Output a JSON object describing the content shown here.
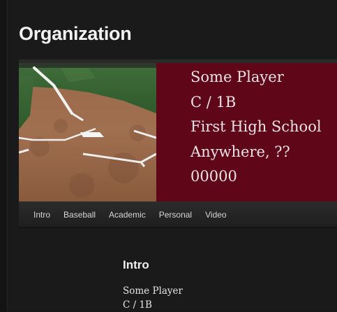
{
  "page": {
    "title": "Organization"
  },
  "hero": {
    "player_name": "Some Player",
    "positions": "C / 1B",
    "school": "First High School",
    "location": "Anywhere, ??",
    "zip": "00000",
    "photo_icon": "baseball-field-photo"
  },
  "nav": {
    "items": [
      {
        "label": "Intro"
      },
      {
        "label": "Baseball"
      },
      {
        "label": "Academic"
      },
      {
        "label": "Personal"
      },
      {
        "label": "Video"
      }
    ]
  },
  "intro": {
    "heading": "Intro",
    "lines": [
      "Some Player",
      "C / 1B"
    ]
  },
  "colors": {
    "background": "#1a1a1a",
    "hero_accent": "#5f0718",
    "text": "#ede3e5"
  }
}
